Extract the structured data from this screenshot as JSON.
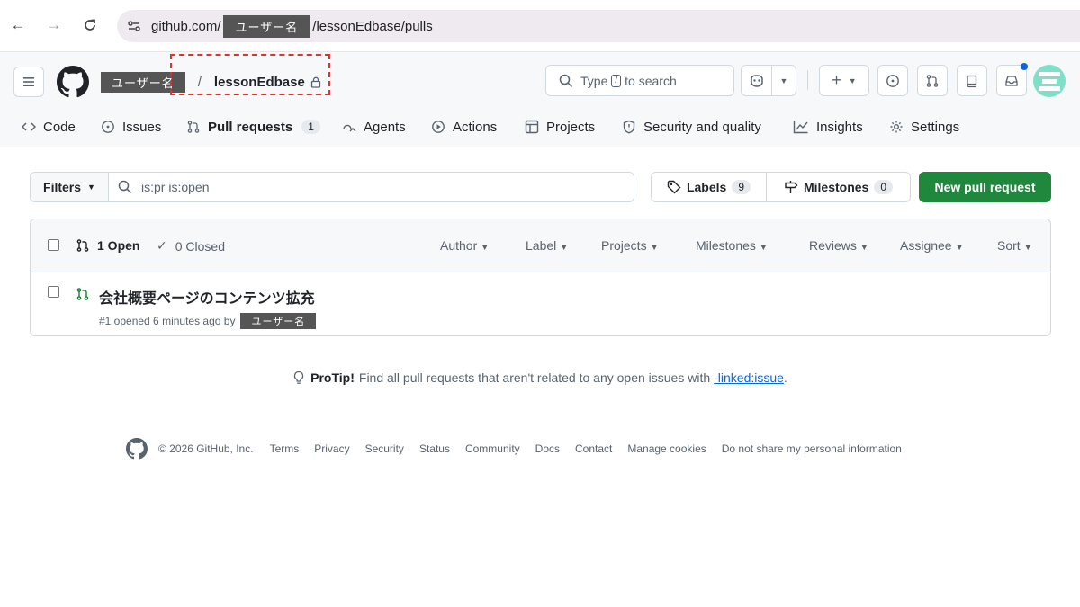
{
  "browser": {
    "url_prefix": "github.com/",
    "url_redacted": "ユーザー名",
    "url_suffix": "/lessonEdbase/pulls"
  },
  "header": {
    "owner": "ユーザー名",
    "separator": "/",
    "repo": "lessonEdbase",
    "search_before": "Type",
    "search_key": "/",
    "search_after": "to search"
  },
  "tabs": [
    {
      "label": "Code"
    },
    {
      "label": "Issues"
    },
    {
      "label": "Pull requests",
      "count": "1"
    },
    {
      "label": "Agents"
    },
    {
      "label": "Actions"
    },
    {
      "label": "Projects"
    },
    {
      "label": "Security and quality"
    },
    {
      "label": "Insights"
    },
    {
      "label": "Settings"
    }
  ],
  "toolbar": {
    "filters_label": "Filters",
    "query": "is:pr is:open",
    "labels_label": "Labels",
    "labels_count": "9",
    "milestones_label": "Milestones",
    "milestones_count": "0",
    "new_pr_label": "New pull request"
  },
  "list": {
    "open_label": "1 Open",
    "closed_label": "0 Closed",
    "filters": [
      "Author",
      "Label",
      "Projects",
      "Milestones",
      "Reviews",
      "Assignee",
      "Sort"
    ],
    "items": [
      {
        "title": "会社概要ページのコンテンツ拡充",
        "meta": "#1 opened 6 minutes ago by",
        "author": "ユーザー名"
      }
    ]
  },
  "protip": {
    "label": "ProTip!",
    "text": "Find all pull requests that aren't related to any open issues with",
    "link": "-linked:issue",
    "end": "."
  },
  "footer": {
    "copyright": "© 2026 GitHub, Inc.",
    "links": [
      "Terms",
      "Privacy",
      "Security",
      "Status",
      "Community",
      "Docs",
      "Contact",
      "Manage cookies",
      "Do not share my personal information"
    ]
  },
  "colors": {
    "accent": "#0969da",
    "primary_button": "#1f883d",
    "open_icon": "#1a7f37",
    "highlight": "#e03030"
  }
}
